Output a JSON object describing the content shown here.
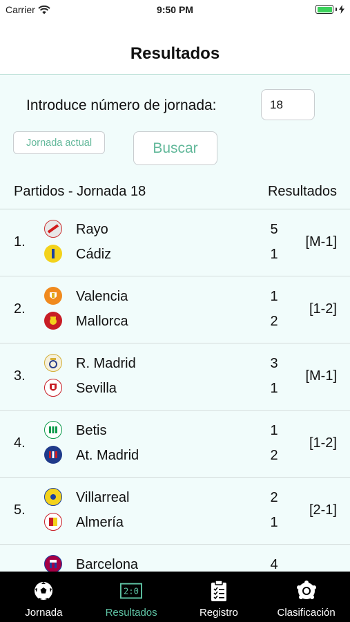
{
  "status_bar": {
    "carrier": "Carrier",
    "time": "9:50 PM"
  },
  "nav": {
    "title": "Resultados"
  },
  "form": {
    "prompt": "Introduce número de jornada:",
    "jornada_value": "18",
    "btn_actual": "Jornada actual",
    "btn_buscar": "Buscar"
  },
  "list": {
    "header_left": "Partidos - Jornada 18",
    "header_right": "Resultados",
    "matches": [
      {
        "num": "1.",
        "home": "Rayo",
        "away": "Cádiz",
        "home_score": "5",
        "away_score": "1",
        "pred": "[M-1]"
      },
      {
        "num": "2.",
        "home": "Valencia",
        "away": "Mallorca",
        "home_score": "1",
        "away_score": "2",
        "pred": "[1-2]"
      },
      {
        "num": "3.",
        "home": "R. Madrid",
        "away": "Sevilla",
        "home_score": "3",
        "away_score": "1",
        "pred": "[M-1]"
      },
      {
        "num": "4.",
        "home": "Betis",
        "away": "At. Madrid",
        "home_score": "1",
        "away_score": "2",
        "pred": "[1-2]"
      },
      {
        "num": "5.",
        "home": "Villarreal",
        "away": "Almería",
        "home_score": "2",
        "away_score": "1",
        "pred": "[2-1]"
      },
      {
        "num": "",
        "home": "Barcelona",
        "away": "",
        "home_score": "4",
        "away_score": "",
        "pred": ""
      }
    ]
  },
  "tabs": [
    {
      "label": "Jornada",
      "icon": "soccer-ball-icon"
    },
    {
      "label": "Resultados",
      "icon": "scoreboard-icon",
      "active": true
    },
    {
      "label": "Registro",
      "icon": "clipboard-icon"
    },
    {
      "label": "Clasificación",
      "icon": "laliga-badge-icon"
    }
  ],
  "colors": {
    "accent": "#5ec3a4",
    "content_bg": "#f1fcfb",
    "tabbar_bg": "#000000"
  }
}
